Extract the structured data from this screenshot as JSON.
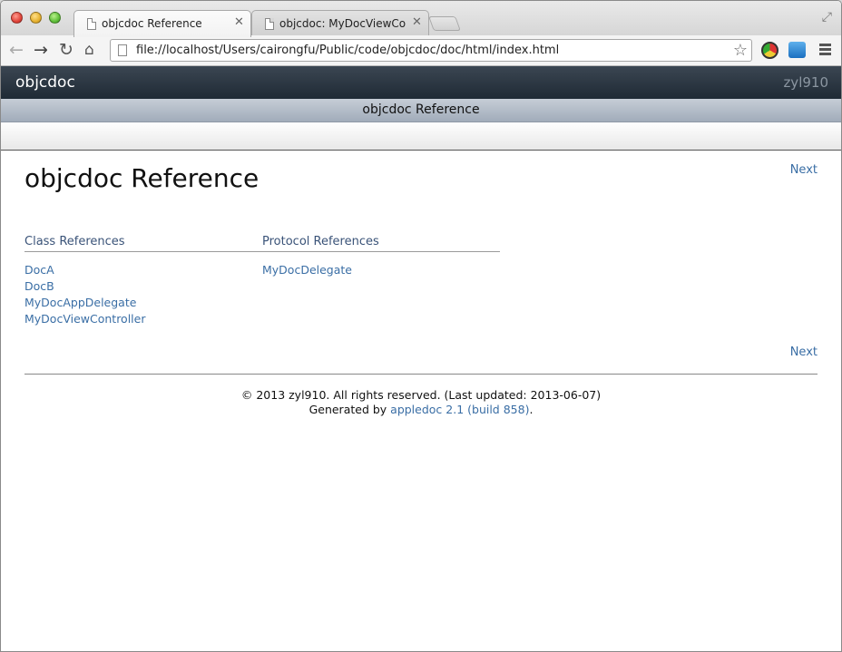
{
  "browser": {
    "tabs": [
      {
        "label": "objcdoc Reference",
        "active": true
      },
      {
        "label": "objcdoc: MyDocViewContr",
        "active": false
      }
    ],
    "url": "file://localhost/Users/cairongfu/Public/code/objcdoc/doc/html/index.html"
  },
  "page": {
    "brand": "objcdoc",
    "company": "zyl910",
    "header_title": "objcdoc Reference",
    "title": "objcdoc Reference",
    "next_label": "Next",
    "class_heading": "Class References",
    "protocol_heading": "Protocol References",
    "classes": [
      "DocA",
      "DocB",
      "MyDocAppDelegate",
      "MyDocViewController"
    ],
    "protocols": [
      "MyDocDelegate"
    ],
    "footer": {
      "copyright": "© 2013 zyl910. All rights reserved. (Last updated: 2013-06-07)",
      "generated_prefix": "Generated by ",
      "generator_link": "appledoc 2.1 (build 858)",
      "generated_suffix": "."
    }
  },
  "colors": {
    "link": "#3a6ea5",
    "nav_bg": "#2c3742",
    "header_bar": "#b3bcc8"
  }
}
